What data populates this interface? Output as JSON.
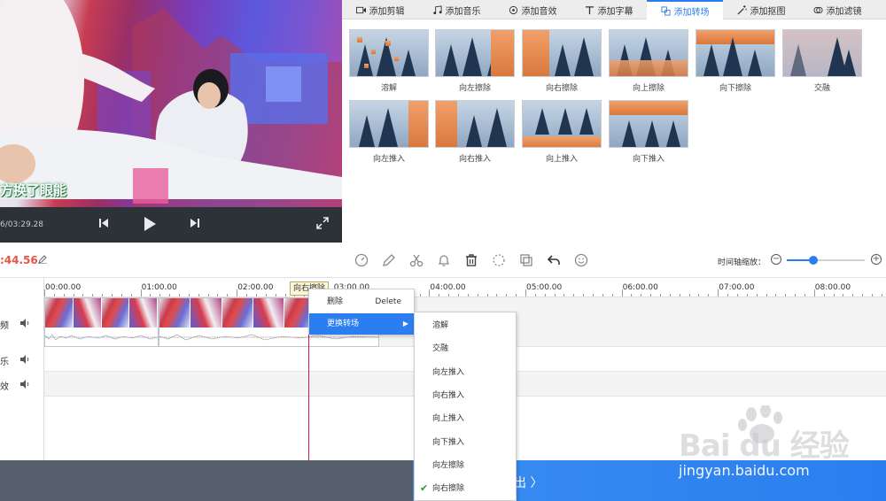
{
  "preview": {
    "caption": "方换了眼能",
    "time_readout": "6/03:29.28",
    "prev_icon": "skip-back-icon",
    "play_icon": "play-icon",
    "next_icon": "skip-forward-icon",
    "fullscreen_icon": "fullscreen-icon"
  },
  "tabs": [
    {
      "label": "添加剪辑",
      "icon": "video-icon"
    },
    {
      "label": "添加音乐",
      "icon": "music-icon"
    },
    {
      "label": "添加音效",
      "icon": "sound-effect-icon"
    },
    {
      "label": "添加字幕",
      "icon": "text-icon"
    },
    {
      "label": "添加转场",
      "icon": "transition-icon",
      "active": true
    },
    {
      "label": "添加抠图",
      "icon": "magic-wand-icon"
    },
    {
      "label": "添加滤镜",
      "icon": "filter-icon"
    }
  ],
  "transitions": [
    {
      "label": "溶解"
    },
    {
      "label": "向左擦除"
    },
    {
      "label": "向右擦除"
    },
    {
      "label": "向上擦除"
    },
    {
      "label": "向下擦除"
    },
    {
      "label": "交融"
    },
    {
      "label": "向左推入"
    },
    {
      "label": "向右推入"
    },
    {
      "label": "向上推入"
    },
    {
      "label": "向下推入"
    }
  ],
  "toolbar": {
    "total_time": ":44.56",
    "zoom_label": "时间轴缩放：",
    "zoom_minus": "−",
    "zoom_plus": "+",
    "zoom_level": 0.34
  },
  "tracks": {
    "video": "频",
    "music": "乐",
    "sfx": "效"
  },
  "ruler": [
    "00:00.00",
    "01:00.00",
    "02:00.00",
    "03:00.00",
    "04:00.00",
    "05:00.00",
    "06:00.00",
    "07:00.00",
    "08:00.00"
  ],
  "tooltip": "向右擦除",
  "context_menu": {
    "delete_label": "删除",
    "delete_shortcut": "Delete",
    "change_label": "更换转场"
  },
  "submenu": [
    {
      "label": "溶解"
    },
    {
      "label": "交融"
    },
    {
      "label": "向左推入"
    },
    {
      "label": "向右推入"
    },
    {
      "label": "向上推入"
    },
    {
      "label": "向下推入"
    },
    {
      "label": "向左擦除"
    },
    {
      "label": "向右擦除",
      "checked": true
    }
  ],
  "export": {
    "label": "出 〉"
  },
  "watermark": {
    "brand": "Bai du 经验",
    "url": "jingyan.baidu.com"
  },
  "colors": {
    "accent": "#2a7ef0",
    "time": "#e5554b",
    "playhead": "#d7195a",
    "check": "#1a9e3a"
  }
}
